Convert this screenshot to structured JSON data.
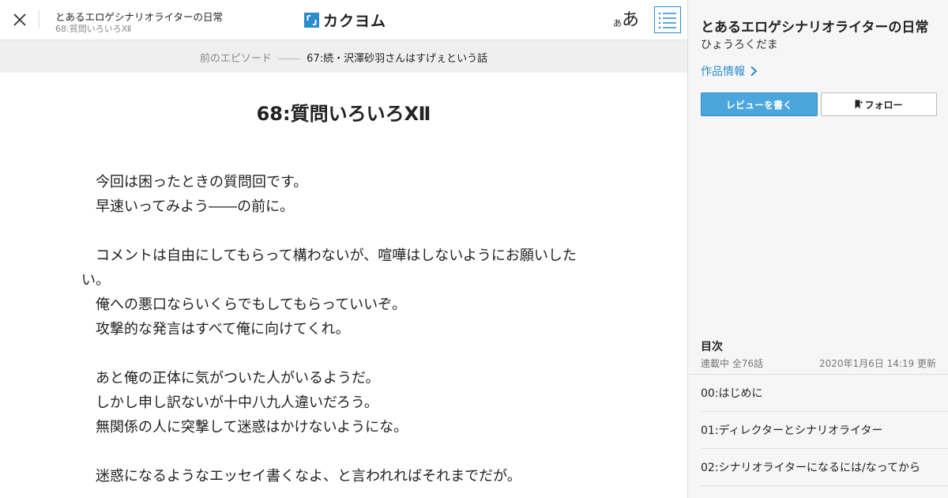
{
  "header": {
    "work_title": "とあるエロゲシナリオライターの日常",
    "episode_subtitle": "68:質問いろいろⅫ",
    "logo_text": "カクヨム",
    "font_size_small": "あ",
    "font_size_big": "あ"
  },
  "prev_nav": {
    "label": "前のエピソード",
    "title": "67:続・沢澤砂羽さんはすげぇという話"
  },
  "episode": {
    "heading": "68:質問いろいろⅫ",
    "paragraphs": [
      "　今回は困ったときの質問回です。",
      "　早速いってみよう――の前に。",
      "",
      "　コメントは自由にしてもらって構わないが、喧嘩はしないようにお願いしたい。",
      "　俺への悪口ならいくらでもしてもらっていいぞ。",
      "　攻撃的な発言はすべて俺に向けてくれ。",
      "",
      "　あと俺の正体に気がついた人がいるようだ。",
      "　しかし申し訳ないが十中八九人違いだろう。",
      "　無関係の人に突撃して迷惑はかけないようにな。",
      "",
      "　迷惑になるようなエッセイ書くなよ、と言われればそれまでだが。"
    ]
  },
  "sidebar": {
    "title": "とあるエロゲシナリオライターの日常",
    "author": "ひょうろくだま",
    "info_link": "作品情報",
    "review_button": "レビューを書く",
    "follow_button": "フォロー",
    "toc_heading": "目次",
    "toc_status": "連載中 全76話",
    "toc_updated": "2020年1月6日 14:19 更新",
    "toc_items": [
      "00:はじめに",
      "01:ディレクターとシナリオライター",
      "02:シナリオライターになるには/なってから"
    ]
  },
  "colors": {
    "accent": "#2a8ccf",
    "review_button": "#4aa6dc",
    "sidebar_bg": "#f6f6f6",
    "prevbar_bg": "#efefef"
  }
}
